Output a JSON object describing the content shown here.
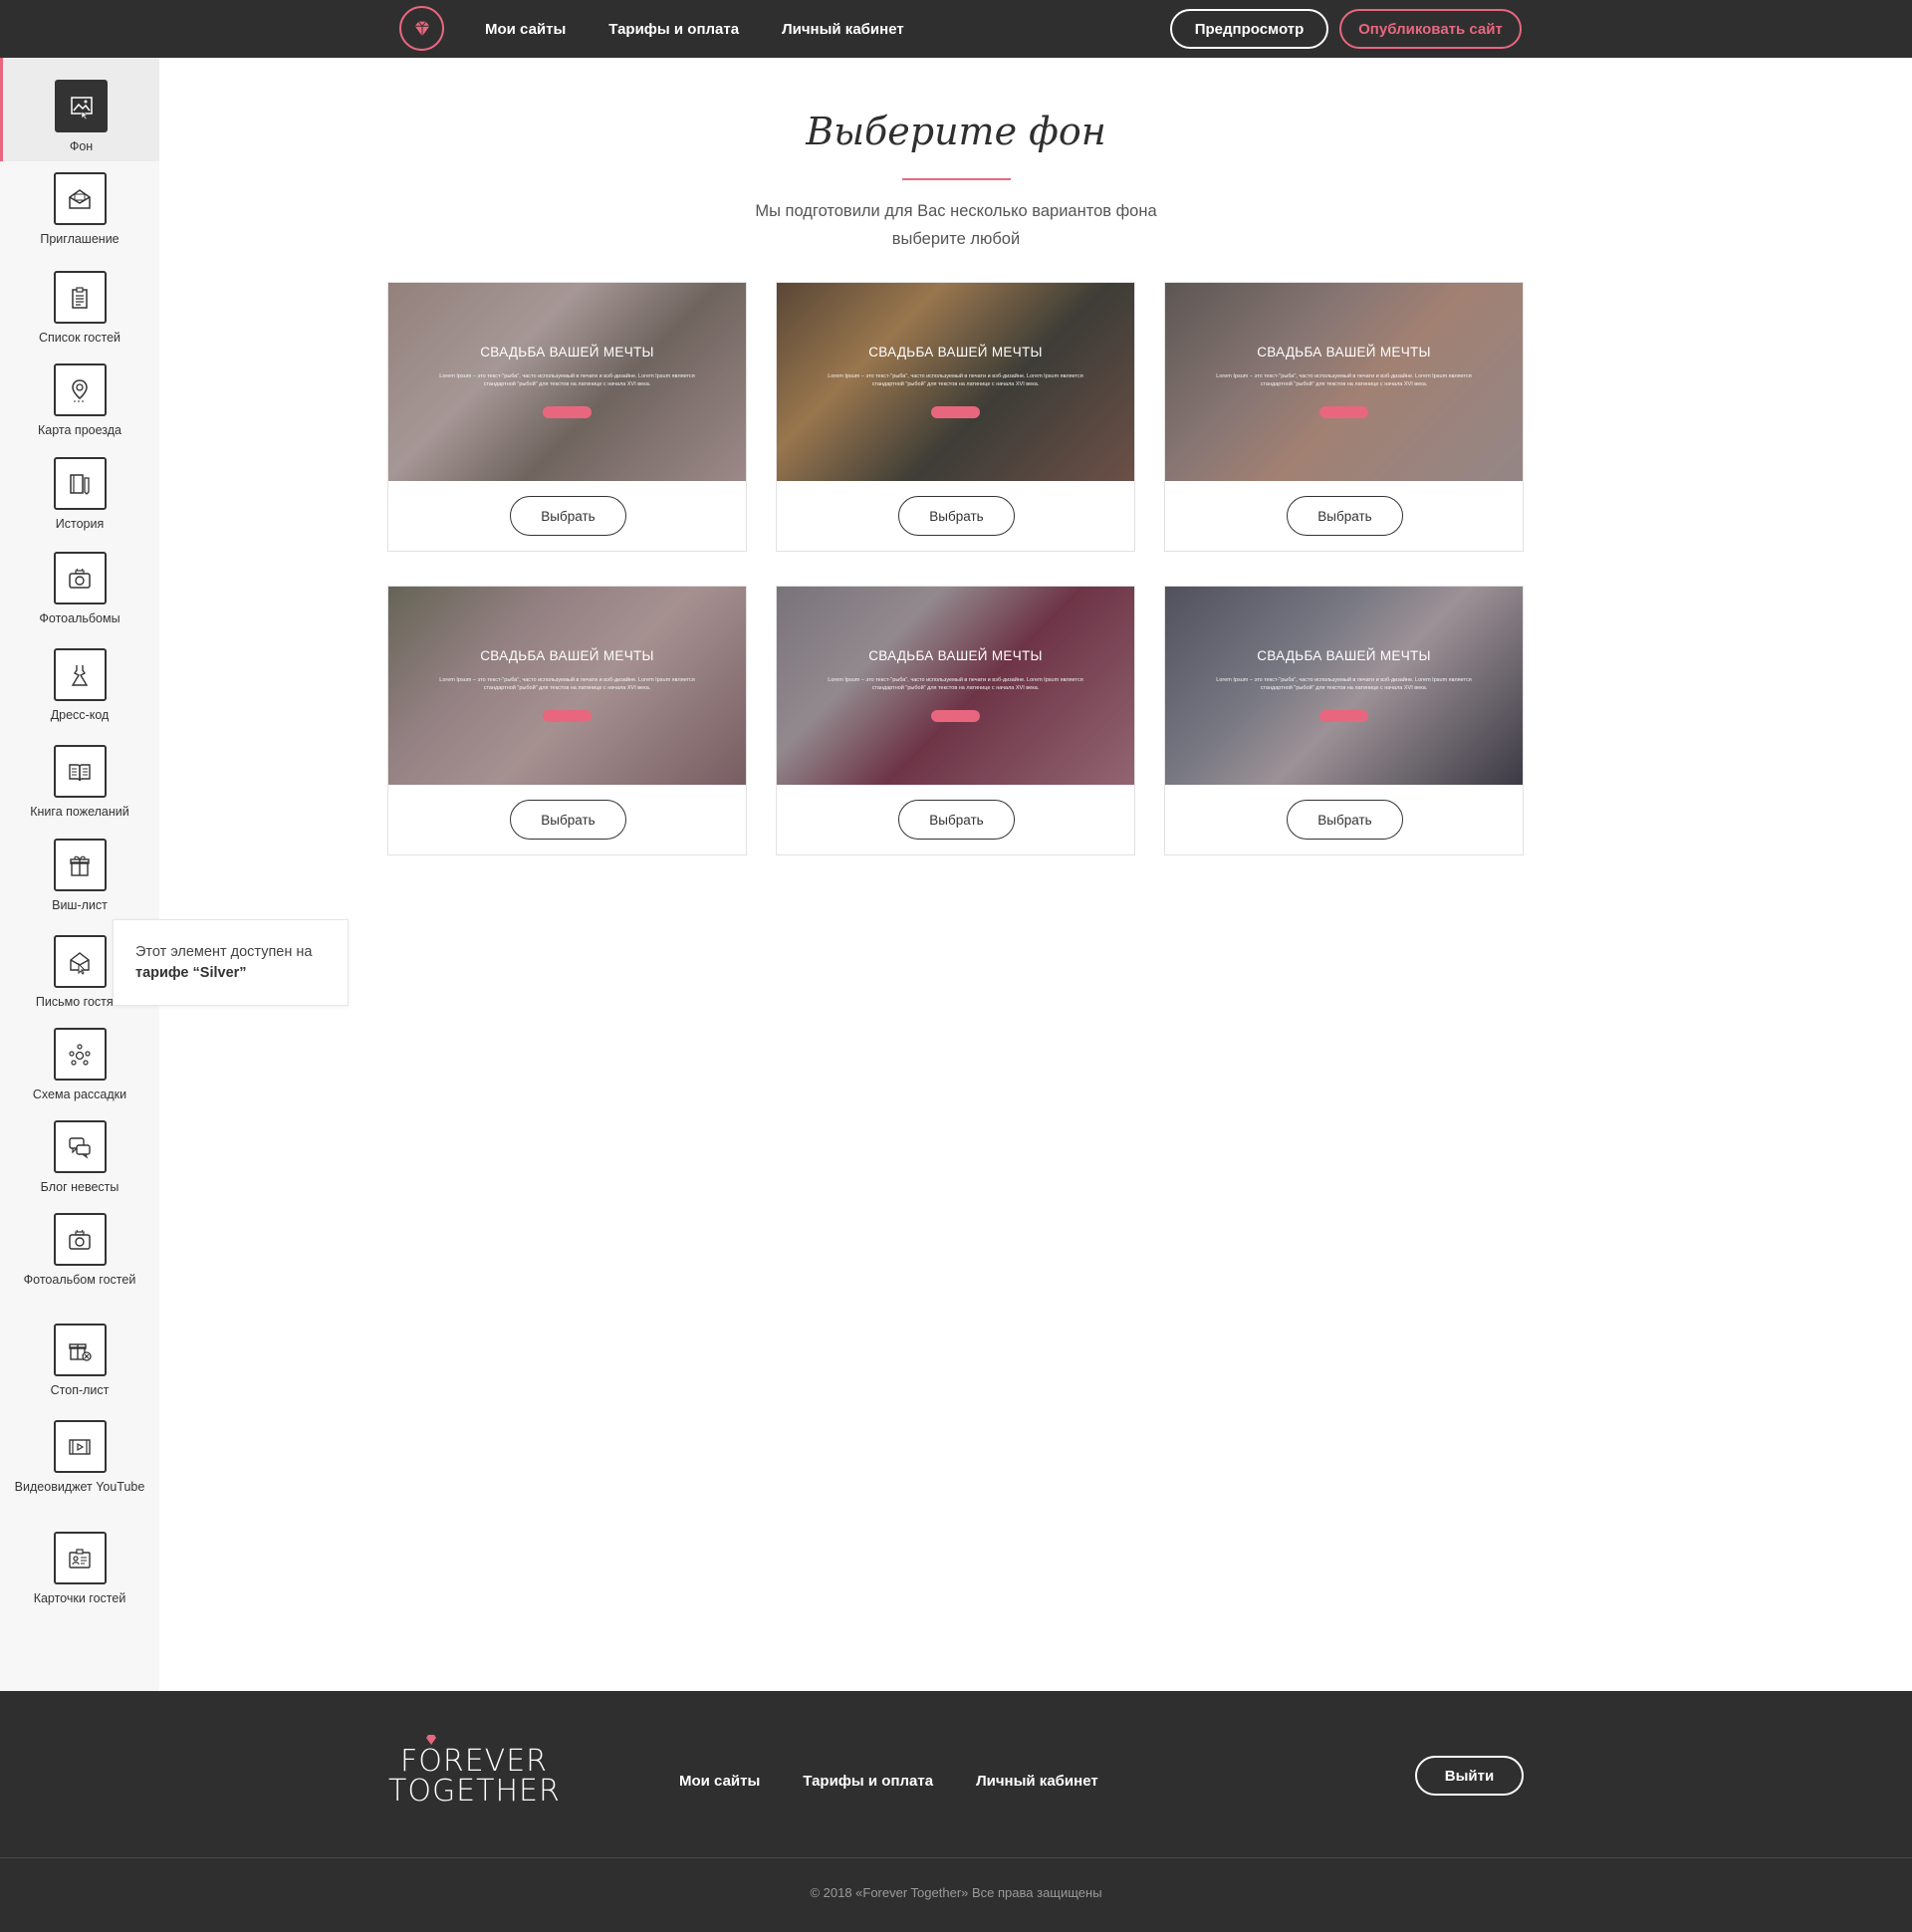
{
  "header": {
    "nav": [
      "Мои сайты",
      "Тарифы и оплата",
      "Личный кабинет"
    ],
    "preview_label": "Предпросмотр",
    "publish_label": "Опубликовать сайт"
  },
  "sidebar": {
    "items": [
      {
        "label": "Фон",
        "icon": "image-icon",
        "active": true
      },
      {
        "label": "Приглашение",
        "icon": "envelope-icon"
      },
      {
        "label": "Список гостей",
        "icon": "clipboard-icon"
      },
      {
        "label": "Карта проезда",
        "icon": "map-pin-icon"
      },
      {
        "label": "История",
        "icon": "book-icon"
      },
      {
        "label": "Фотоальбомы",
        "icon": "camera-icon"
      },
      {
        "label": "Дресс-код",
        "icon": "dress-icon"
      },
      {
        "label": "Книга пожеланий",
        "icon": "open-book-icon"
      },
      {
        "label": "Виш-лист",
        "icon": "gift-icon"
      },
      {
        "label": "Письмо гостя...",
        "icon": "letter-icon"
      },
      {
        "label": "Схема рассадки",
        "icon": "seating-icon"
      },
      {
        "label": "Блог невесты",
        "icon": "chat-icon"
      },
      {
        "label": "Фотоальбом гостей",
        "icon": "camera-icon"
      },
      {
        "label": "Стоп-лист",
        "icon": "gift-cancel-icon"
      },
      {
        "label": "Видеовиджет YouTube",
        "icon": "video-icon"
      },
      {
        "label": "Карточки гостей",
        "icon": "id-card-icon"
      }
    ]
  },
  "tooltip": {
    "text": "Этот элемент доступен на",
    "bold": "тарифе “Silver”"
  },
  "main": {
    "title": "Выберите фон",
    "subtitle_line1": "Мы подготовили для Вас несколько вариантов фона",
    "subtitle_line2": "выберите любой",
    "cards": [
      {
        "headline": "СВАДЬБА ВАШЕЙ МЕЧТЫ",
        "button": "Выбрать"
      },
      {
        "headline": "СВАДЬБА ВАШЕЙ МЕЧТЫ",
        "button": "Выбрать"
      },
      {
        "headline": "СВАДЬБА ВАШЕЙ МЕЧТЫ",
        "button": "Выбрать"
      },
      {
        "headline": "СВАДЬБА ВАШЕЙ МЕЧТЫ",
        "button": "Выбрать"
      },
      {
        "headline": "СВАДЬБА ВАШЕЙ МЕЧТЫ",
        "button": "Выбрать"
      },
      {
        "headline": "СВАДЬБА ВАШЕЙ МЕЧТЫ",
        "button": "Выбрать"
      }
    ],
    "lorem": "Lorem Ipsum – это текст-\"рыба\", часто используемый в печати и вэб-дизайне. Lorem Ipsum является стандартной \"рыбой\" для текстов на латинице с начала XVI века."
  },
  "footer": {
    "logo_line1": "FOREVER",
    "logo_line2": "TOGETHER",
    "nav": [
      "Мои сайты",
      "Тарифы и оплата",
      "Личный кабинет"
    ],
    "logout_label": "Выйти",
    "copyright": "© 2018 «Forever Together» Все права защищены"
  },
  "colors": {
    "accent": "#e8677f",
    "dark": "#2f2f2f"
  }
}
